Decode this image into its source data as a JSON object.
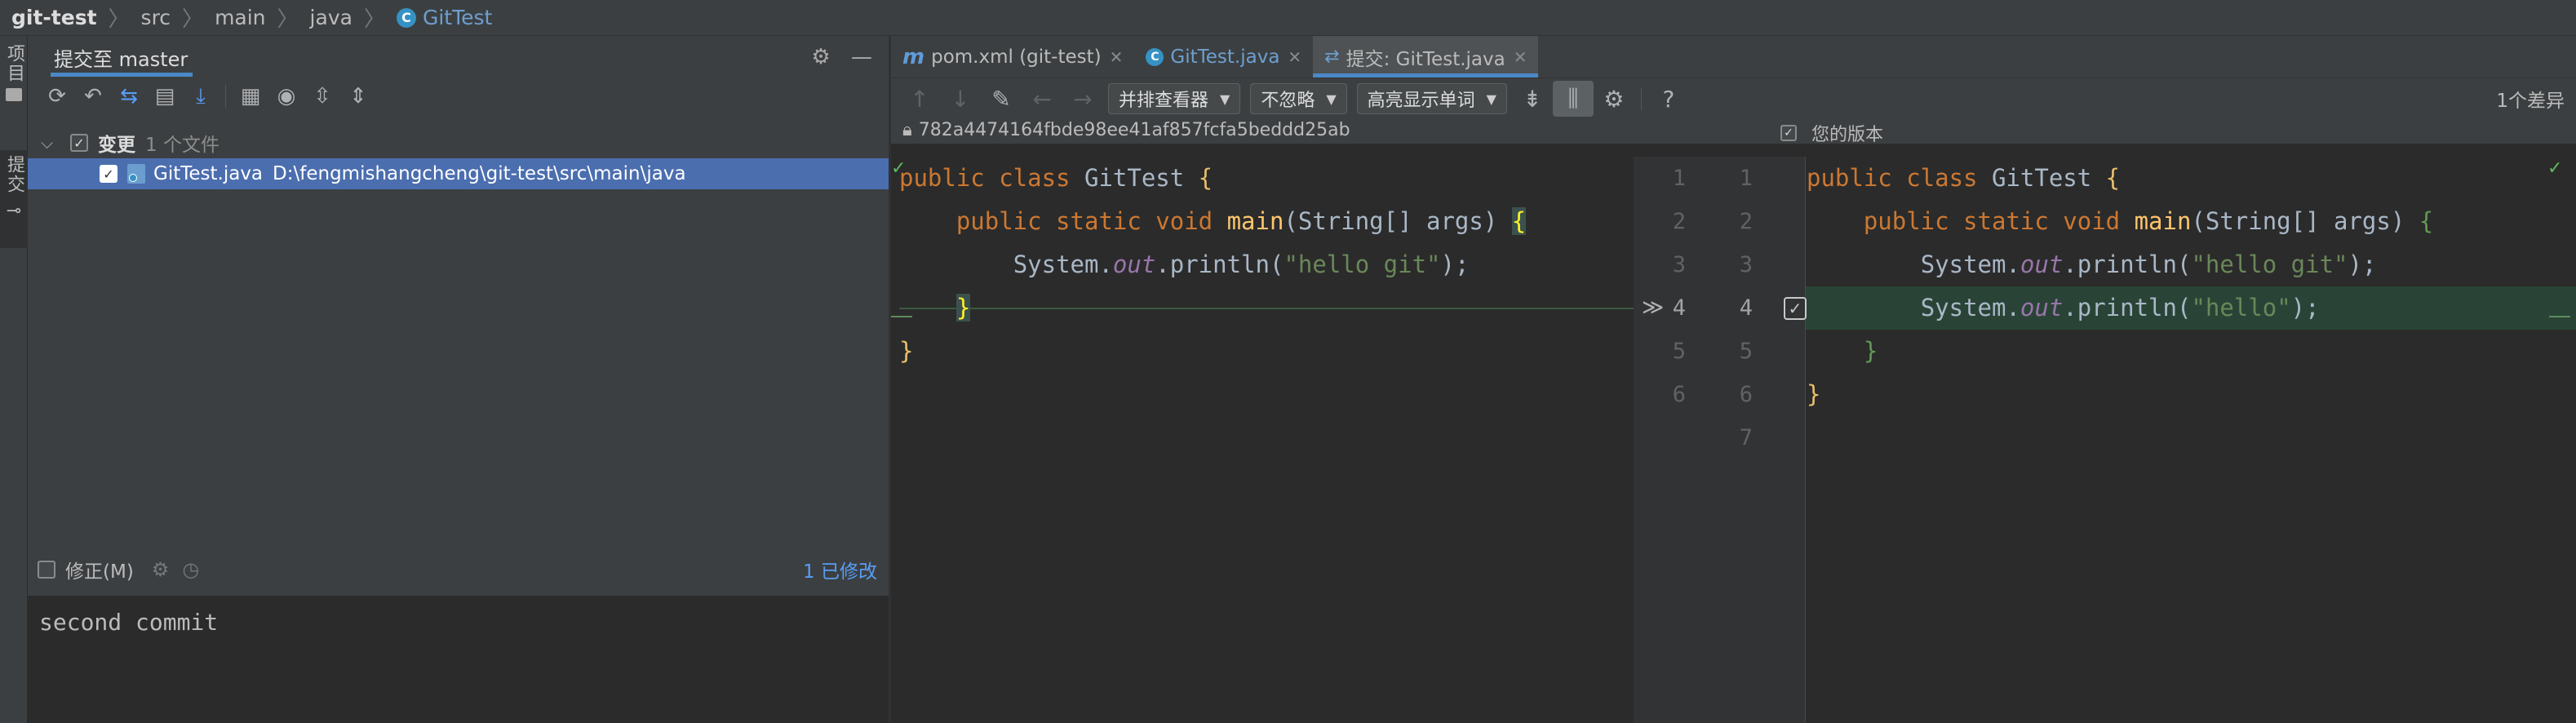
{
  "breadcrumb": {
    "items": [
      "git-test",
      "src",
      "main",
      "java",
      "GitTest"
    ]
  },
  "stripe": {
    "project_label": "项目",
    "commit_label": "提交"
  },
  "commit_panel": {
    "title": "提交至 master",
    "settings_icon": "gear-icon",
    "minimize_icon": "minimize-icon",
    "toolbar_icons": [
      "refresh-icon",
      "rollback-icon",
      "diff-icon",
      "shelve-icon",
      "update-icon",
      "group-by-icon",
      "eye-icon",
      "expand-all-icon",
      "collapse-all-icon"
    ],
    "tree": {
      "group_label": "变更",
      "group_count": "1 个文件",
      "file_name": "GitTest.java",
      "file_path": "D:\\fengmishangcheng\\git-test\\src\\main\\java"
    },
    "amend_label": "修正(M)",
    "modified_link": "1 已修改",
    "commit_message": "second commit"
  },
  "editor": {
    "tabs": [
      {
        "label": "pom.xml (git-test)",
        "icon": "maven-icon"
      },
      {
        "label": "GitTest.java",
        "icon": "java-class-icon"
      },
      {
        "label": "提交: GitTest.java",
        "icon": "diff-tab-icon"
      }
    ],
    "toolbar": {
      "viewer_dropdown": "并排查看器",
      "ignore_dropdown": "不忽略",
      "highlight_dropdown": "高亮显示单词",
      "help": "?",
      "diff_count": "1个差异"
    },
    "left_header": "782a4474164fbde98ee41af857fcfa5beddd25ab",
    "right_header": "您的版本",
    "left_line_numbers": [
      "1",
      "2",
      "3",
      "4",
      "5",
      "6"
    ],
    "right_line_numbers": [
      "1",
      "2",
      "3",
      "4",
      "5",
      "6",
      "7"
    ],
    "left_code": {
      "l1_kw": "public class ",
      "l1_name": "GitTest ",
      "l1_brace": "{",
      "l2_indent": "    ",
      "l2_kw": "public static void ",
      "l2_fn": "main",
      "l2_args": "(String[] args) ",
      "l2_brace": "{",
      "l3_indent": "        ",
      "l3_sys": "System.",
      "l3_out": "out",
      "l3_call": ".println(",
      "l3_str": "\"hello git\"",
      "l3_end": ");",
      "l4_indent": "    ",
      "l4_brace": "}",
      "l5_brace": "}"
    },
    "right_code": {
      "l1_kw": "public class ",
      "l1_name": "GitTest ",
      "l1_brace": "{",
      "l2_indent": "    ",
      "l2_kw": "public static void ",
      "l2_fn": "main",
      "l2_args": "(String[] args) ",
      "l2_brace": "{",
      "l3_indent": "        ",
      "l3_sys": "System.",
      "l3_out": "out",
      "l3_call": ".println(",
      "l3_str": "\"hello git\"",
      "l3_end": ");",
      "l4_indent": "        ",
      "l4_sys": "System.",
      "l4_out": "out",
      "l4_call": ".println(",
      "l4_str": "\"hello\"",
      "l4_end": ");",
      "l5_indent": "    ",
      "l5_brace": "}",
      "l6_brace": "}"
    }
  },
  "colors": {
    "accent": "#4a88c7",
    "selection": "#4b6eaf",
    "added_line": "#294436",
    "keyword": "#cc7832",
    "string": "#6a8759",
    "function": "#ffc66d"
  }
}
